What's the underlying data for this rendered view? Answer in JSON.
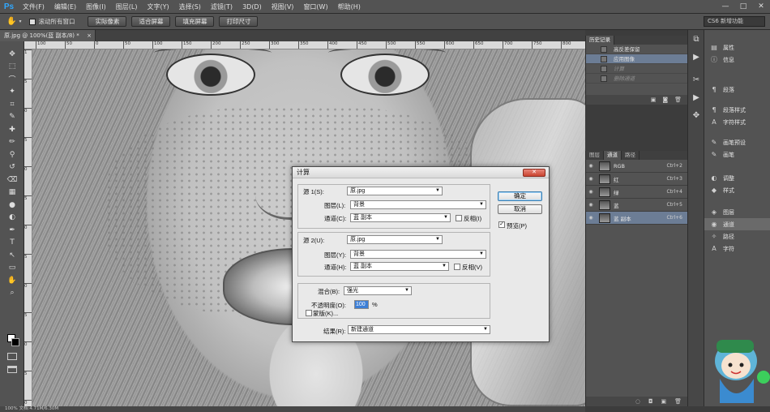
{
  "app": {
    "logo": "Ps",
    "menu": [
      "文件(F)",
      "编辑(E)",
      "图像(I)",
      "图层(L)",
      "文字(Y)",
      "选择(S)",
      "滤镜(T)",
      "3D(D)",
      "视图(V)",
      "窗口(W)",
      "帮助(H)"
    ],
    "window_controls": [
      "—",
      "□",
      "✕"
    ]
  },
  "options": {
    "scroll_all_windows": "滚动所有窗口",
    "btn_actual_pixels": "实际像素",
    "btn_fit_screen": "适合屏幕",
    "btn_fill_screen": "填充屏幕",
    "btn_print_size": "打印尺寸",
    "workspace": "CS6 新增功能"
  },
  "document": {
    "tab_title": "原.jpg @ 100%(蓝 副本/8) *",
    "tab_close": "×",
    "status": "100%     文档:4.71M/6.30M"
  },
  "ruler": {
    "h_ticks": [
      "150",
      "100",
      "50",
      "0",
      "50",
      "100",
      "150",
      "200",
      "250",
      "300",
      "350",
      "400",
      "450",
      "500",
      "550",
      "600",
      "650",
      "700",
      "750",
      "800"
    ],
    "v_ticks": [
      "1",
      "5",
      "0",
      "5",
      "0",
      "5",
      "0",
      "5",
      "0",
      "5",
      "0",
      "5",
      "0"
    ]
  },
  "tools": [
    "move-icon",
    "marquee-icon",
    "lasso-icon",
    "quick-select-icon",
    "crop-icon",
    "eyedropper-icon",
    "heal-icon",
    "brush-icon",
    "stamp-icon",
    "history-brush-icon",
    "eraser-icon",
    "gradient-icon",
    "blur-icon",
    "dodge-icon",
    "pen-icon",
    "type-icon",
    "path-select-icon",
    "shape-icon",
    "hand-icon",
    "zoom-icon"
  ],
  "dialog": {
    "title": "计算",
    "source1_label": "源 1(S):",
    "source1_value": "原.jpg",
    "layer1_label": "图层(L):",
    "layer1_value": "背景",
    "channel1_label": "通道(C):",
    "channel1_value": "蓝 副本",
    "invert1_label": "反相(I)",
    "source2_label": "源 2(U):",
    "source2_value": "原.jpg",
    "layer2_label": "图层(Y):",
    "layer2_value": "背景",
    "channel2_label": "通道(H):",
    "channel2_value": "蓝 副本",
    "invert2_label": "反相(V)",
    "blend_label": "混合(B):",
    "blend_value": "强光",
    "opacity_label": "不透明度(O):",
    "opacity_value": "100",
    "opacity_unit": "%",
    "mask_label": "蒙版(K)...",
    "result_label": "结果(R):",
    "result_value": "新建通道",
    "ok": "确定",
    "cancel": "取消",
    "preview": "预览(P)",
    "preview_checked": true
  },
  "history": {
    "tab": "历史记录",
    "items": [
      {
        "label": "高反差保留",
        "state": "normal"
      },
      {
        "label": "应用图像",
        "state": "active"
      },
      {
        "label": "计算",
        "state": "dim"
      },
      {
        "label": "删除通道",
        "state": "dim"
      }
    ]
  },
  "channels": {
    "tabs": [
      "图层",
      "通道",
      "路径"
    ],
    "active_tab": 1,
    "rows": [
      {
        "name": "RGB",
        "key": "Ctrl+2",
        "active": false
      },
      {
        "name": "红",
        "key": "Ctrl+3",
        "active": false
      },
      {
        "name": "绿",
        "key": "Ctrl+4",
        "active": false
      },
      {
        "name": "蓝",
        "key": "Ctrl+5",
        "active": false
      },
      {
        "name": "蓝 副本",
        "key": "Ctrl+6",
        "active": true
      }
    ]
  },
  "right_panel": {
    "items": [
      {
        "label": "属性",
        "icon": "properties-icon",
        "glyph": "▤"
      },
      {
        "label": "信息",
        "icon": "info-icon",
        "glyph": "ⓘ"
      },
      {
        "label": "段落",
        "icon": "paragraph-icon",
        "glyph": "¶"
      },
      {
        "label": "段落样式",
        "icon": "paragraph-style-icon",
        "glyph": "¶"
      },
      {
        "label": "字符样式",
        "icon": "char-style-icon",
        "glyph": "A"
      },
      {
        "label": "画笔预设",
        "icon": "brush-preset-icon",
        "glyph": "✎"
      },
      {
        "label": "画笔",
        "icon": "brush-panel-icon",
        "glyph": "✎"
      },
      {
        "label": "调整",
        "icon": "adjustments-icon",
        "glyph": "◐"
      },
      {
        "label": "样式",
        "icon": "styles-icon",
        "glyph": "◆"
      },
      {
        "label": "图层",
        "icon": "layers-icon",
        "glyph": "◈"
      },
      {
        "label": "通道",
        "icon": "channels-icon",
        "glyph": "◉"
      },
      {
        "label": "路径",
        "icon": "paths-icon",
        "glyph": "✧"
      },
      {
        "label": "字符",
        "icon": "character-icon",
        "glyph": "A"
      }
    ],
    "active_index": 10
  },
  "colors": {
    "accent_selected": "#6c7d95",
    "ps_blue": "#30a8ff"
  }
}
